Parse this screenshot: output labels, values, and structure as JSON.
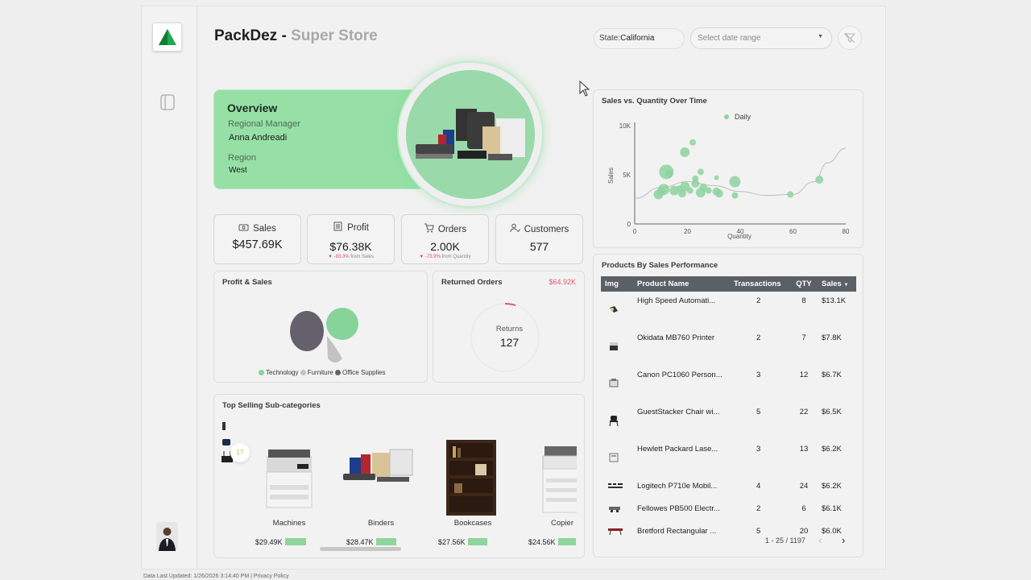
{
  "header": {
    "brand": "PackDez",
    "separator": " - ",
    "subtitle": "Super Store",
    "state_filter_label": "State:",
    "state_filter_value": "California",
    "date_placeholder": "Select date range"
  },
  "overview": {
    "title": "Overview",
    "manager_label": "Regional Manager",
    "manager_name": "Anna Andreadi",
    "region_label": "Region",
    "region_value": "West"
  },
  "kpis": [
    {
      "label": "Sales",
      "value": "$457.69K",
      "delta": "",
      "delta_note": ""
    },
    {
      "label": "Profit",
      "value": "$76.38K",
      "delta": "-83.3%",
      "delta_note": "from Sales"
    },
    {
      "label": "Orders",
      "value": "2.00K",
      "delta": "-73.9%",
      "delta_note": "from Quantity"
    },
    {
      "label": "Customers",
      "value": "577",
      "delta": "",
      "delta_note": ""
    }
  ],
  "profit_sales": {
    "title": "Profit & Sales",
    "legend": [
      "Technology",
      "Furniture",
      "Office Supplies"
    ],
    "colors": {
      "technology": "#86d49a",
      "furniture": "#c2c2c2",
      "office_supplies": "#65616c"
    }
  },
  "returned": {
    "title": "Returned Orders",
    "amount": "$64.92K",
    "label": "Returns",
    "count": "127",
    "accent": "#e0556e"
  },
  "subcategories": {
    "title": "Top Selling Sub-categories",
    "badge": "17",
    "items": [
      {
        "name": "Machines",
        "value": "$29.49K",
        "share": 0.88
      },
      {
        "name": "Binders",
        "value": "$28.47K",
        "share": 0.85
      },
      {
        "name": "Bookcases",
        "value": "$27.56K",
        "share": 0.82
      },
      {
        "name": "Copier",
        "value": "$24.56K",
        "share": 0.73
      }
    ]
  },
  "chart_data": {
    "type": "scatter",
    "title": "Sales vs. Quantity Over Time",
    "xlabel": "Quantity",
    "ylabel": "Sales",
    "xlim": [
      0,
      80
    ],
    "ylim": [
      0,
      10000
    ],
    "xticks": [
      "0",
      "20",
      "40",
      "60",
      "80"
    ],
    "yticks": [
      "0",
      "5K",
      "10K"
    ],
    "legend": "top",
    "series": [
      {
        "name": "Daily",
        "color": "#8ed4a0",
        "points": [
          {
            "x": 9,
            "y": 3000,
            "s": 6
          },
          {
            "x": 10,
            "y": 3300,
            "s": 5
          },
          {
            "x": 11,
            "y": 3500,
            "s": 7
          },
          {
            "x": 12,
            "y": 5300,
            "s": 9
          },
          {
            "x": 13,
            "y": 5100,
            "s": 5
          },
          {
            "x": 15,
            "y": 3400,
            "s": 6
          },
          {
            "x": 17,
            "y": 3600,
            "s": 4
          },
          {
            "x": 18,
            "y": 3100,
            "s": 5
          },
          {
            "x": 19,
            "y": 3800,
            "s": 6
          },
          {
            "x": 19,
            "y": 7300,
            "s": 6
          },
          {
            "x": 21,
            "y": 3400,
            "s": 4
          },
          {
            "x": 22,
            "y": 8300,
            "s": 4
          },
          {
            "x": 23,
            "y": 4600,
            "s": 4
          },
          {
            "x": 23,
            "y": 4100,
            "s": 5
          },
          {
            "x": 25,
            "y": 5300,
            "s": 4
          },
          {
            "x": 25,
            "y": 3200,
            "s": 6
          },
          {
            "x": 26,
            "y": 3700,
            "s": 5
          },
          {
            "x": 28,
            "y": 3400,
            "s": 4
          },
          {
            "x": 31,
            "y": 3300,
            "s": 5
          },
          {
            "x": 31,
            "y": 4700,
            "s": 3
          },
          {
            "x": 32,
            "y": 3100,
            "s": 5
          },
          {
            "x": 38,
            "y": 4300,
            "s": 7
          },
          {
            "x": 38,
            "y": 2900,
            "s": 4
          },
          {
            "x": 59,
            "y": 3000,
            "s": 4
          },
          {
            "x": 70,
            "y": 4500,
            "s": 5
          }
        ]
      }
    ],
    "trend": [
      {
        "x": 0,
        "y": 2600
      },
      {
        "x": 10,
        "y": 3700
      },
      {
        "x": 20,
        "y": 4300
      },
      {
        "x": 30,
        "y": 3900
      },
      {
        "x": 40,
        "y": 3300
      },
      {
        "x": 50,
        "y": 2900
      },
      {
        "x": 60,
        "y": 3000
      },
      {
        "x": 68,
        "y": 4300
      },
      {
        "x": 73,
        "y": 6200
      },
      {
        "x": 80,
        "y": 7700
      }
    ]
  },
  "products": {
    "title": "Products By Sales Performance",
    "columns": [
      "Img",
      "Product Name",
      "Transactions",
      "QTY",
      "Sales"
    ],
    "rows": [
      {
        "name": "High Speed Automati...",
        "transactions": "2",
        "qty": "8",
        "sales": "$13.1K"
      },
      {
        "name": "Okidata MB760 Printer",
        "transactions": "2",
        "qty": "7",
        "sales": "$7.8K"
      },
      {
        "name": "Canon PC1060 Person...",
        "transactions": "3",
        "qty": "12",
        "sales": "$6.7K"
      },
      {
        "name": "GuestStacker Chair wi...",
        "transactions": "5",
        "qty": "22",
        "sales": "$6.5K"
      },
      {
        "name": "Hewlett Packard Lase...",
        "transactions": "3",
        "qty": "13",
        "sales": "$6.2K"
      },
      {
        "name": "Logitech P710e Mobil...",
        "transactions": "4",
        "qty": "24",
        "sales": "$6.2K"
      },
      {
        "name": "Fellowes PB500 Electr...",
        "transactions": "2",
        "qty": "6",
        "sales": "$6.1K"
      },
      {
        "name": "Bretford Rectangular ...",
        "transactions": "5",
        "qty": "20",
        "sales": "$6.0K"
      }
    ],
    "pagination": "1 - 25 / 1197"
  },
  "footer": {
    "updated": "Data Last Updated: 1/26/2026 3:14:40 PM",
    "sep": " | ",
    "privacy": "Privacy Policy"
  }
}
